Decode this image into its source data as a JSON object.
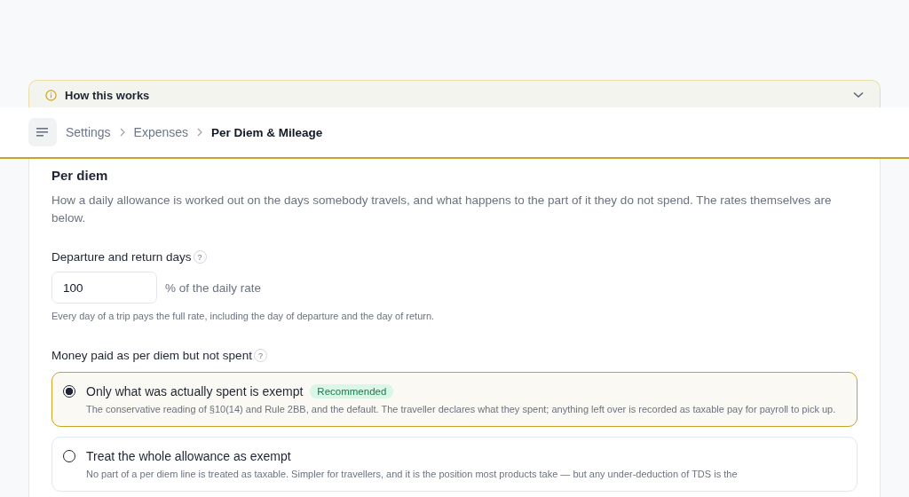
{
  "notice": {
    "title": "How this works",
    "expanded": false
  },
  "breadcrumb": [
    {
      "label": "Settings",
      "current": false
    },
    {
      "label": "Expenses",
      "current": false
    },
    {
      "label": "Per Diem & Mileage",
      "current": true
    }
  ],
  "section": {
    "title": "Per diem",
    "description": "How a daily allowance is worked out on the days somebody travels, and what happens to the part of it they do not spend. The rates themselves are below."
  },
  "departure": {
    "label": "Departure and return days",
    "help": "?",
    "value": "100",
    "suffix": "% of the daily rate",
    "hint": "Every day of a trip pays the full rate, including the day of departure and the day of return."
  },
  "unspent": {
    "label": "Money paid as per diem but not spent",
    "help": "?",
    "options": [
      {
        "title": "Only what was actually spent is exempt",
        "badge": "Recommended",
        "selected": true,
        "description": "The conservative reading of §10(14) and Rule 2BB, and the default. The traveller declares what they spent; anything left over is recorded as taxable pay for payroll to pick up."
      },
      {
        "title": "Treat the whole allowance as exempt",
        "selected": false,
        "description": "No part of a per diem line is treated as taxable. Simpler for travellers, and it is the position most products take — but any under-deduction of TDS is the"
      }
    ]
  }
}
